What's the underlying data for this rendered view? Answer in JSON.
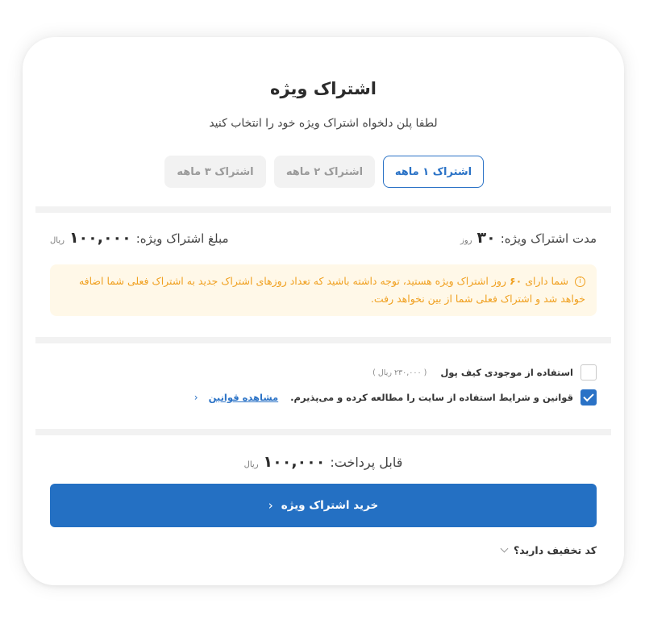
{
  "header": {
    "title": "اشتراک ویژه",
    "subtitle": "لطفا پلن دلخواه اشتراک ویژه خود را انتخاب کنید"
  },
  "plans": {
    "tabs": [
      {
        "label": "اشتراک ۱ ماهه",
        "active": true
      },
      {
        "label": "اشتراک ۲ ماهه",
        "active": false
      },
      {
        "label": "اشتراک ۳ ماهه",
        "active": false
      }
    ]
  },
  "summary": {
    "duration_label": "مدت اشتراک ویژه:",
    "duration_value": "۳۰",
    "duration_unit": "روز",
    "amount_label": "مبلغ اشتراک ویژه:",
    "amount_value": "۱۰۰,۰۰۰",
    "amount_unit": "ریال"
  },
  "notice": {
    "icon": "info-icon",
    "text_before": "شما دارای",
    "days": "۶۰",
    "text_after": "روز اشتراک ویژه هستید، توجه داشته باشید که تعداد روزهای اشتراک جدید به اشتراک فعلی شما اضافه خواهد شد و اشتراک فعلی شما از بین نخواهد رفت."
  },
  "options": {
    "wallet_label": "استفاده از موجودی کیف پول",
    "wallet_balance": "( ۲۳۰,۰۰۰ ریال )",
    "wallet_checked": false,
    "terms_label": "قوانین و شرایط استفاده از سایت را مطالعه کرده و می‌پذیرم.",
    "terms_link": "مشاهده قوانین",
    "terms_checked": true
  },
  "payment": {
    "payable_label": "قابل پرداخت:",
    "payable_value": "۱۰۰,۰۰۰",
    "payable_unit": "ریال",
    "buy_label": "خرید اشتراک ویژه",
    "discount_label": "کد تخفیف دارید؟"
  },
  "colors": {
    "accent": "#2470c3",
    "notice_bg": "#fff8e8",
    "notice_text": "#f0a020"
  }
}
